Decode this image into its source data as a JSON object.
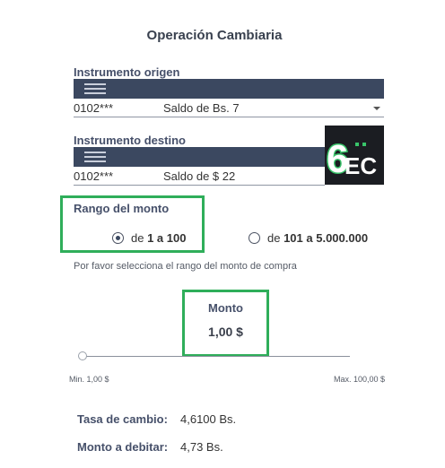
{
  "title": "Operación Cambiaria",
  "origen": {
    "label": "Instrumento origen",
    "code": "0102***",
    "text": "Saldo de Bs. 7"
  },
  "destino": {
    "label": "Instrumento destino",
    "code": "0102***",
    "text": "Saldo de $ 22"
  },
  "logo": {
    "text": "6EC"
  },
  "rango": {
    "label": "Rango del monto",
    "option1": {
      "prefix": "de ",
      "value": "1 a 100",
      "selected": true
    },
    "option2": {
      "prefix": "de ",
      "value": "101 a 5.000.000",
      "selected": false
    }
  },
  "hint": "Por favor selecciona el rango del monto de compra",
  "monto": {
    "label": "Monto",
    "value": "1,00 $",
    "min_label": "Min. 1,00 $",
    "max_label": "Max. 100,00 $",
    "level": 0
  },
  "tasa": {
    "label": "Tasa de cambio:",
    "value": "4,6100 Bs."
  },
  "debitar": {
    "label": "Monto a debitar:",
    "value": "4,73 Bs."
  },
  "colors": {
    "accent": "#3b4860",
    "highlight": "#2fae5a",
    "logo_bg": "#1b1d22",
    "logo_green": "#39c46a"
  }
}
